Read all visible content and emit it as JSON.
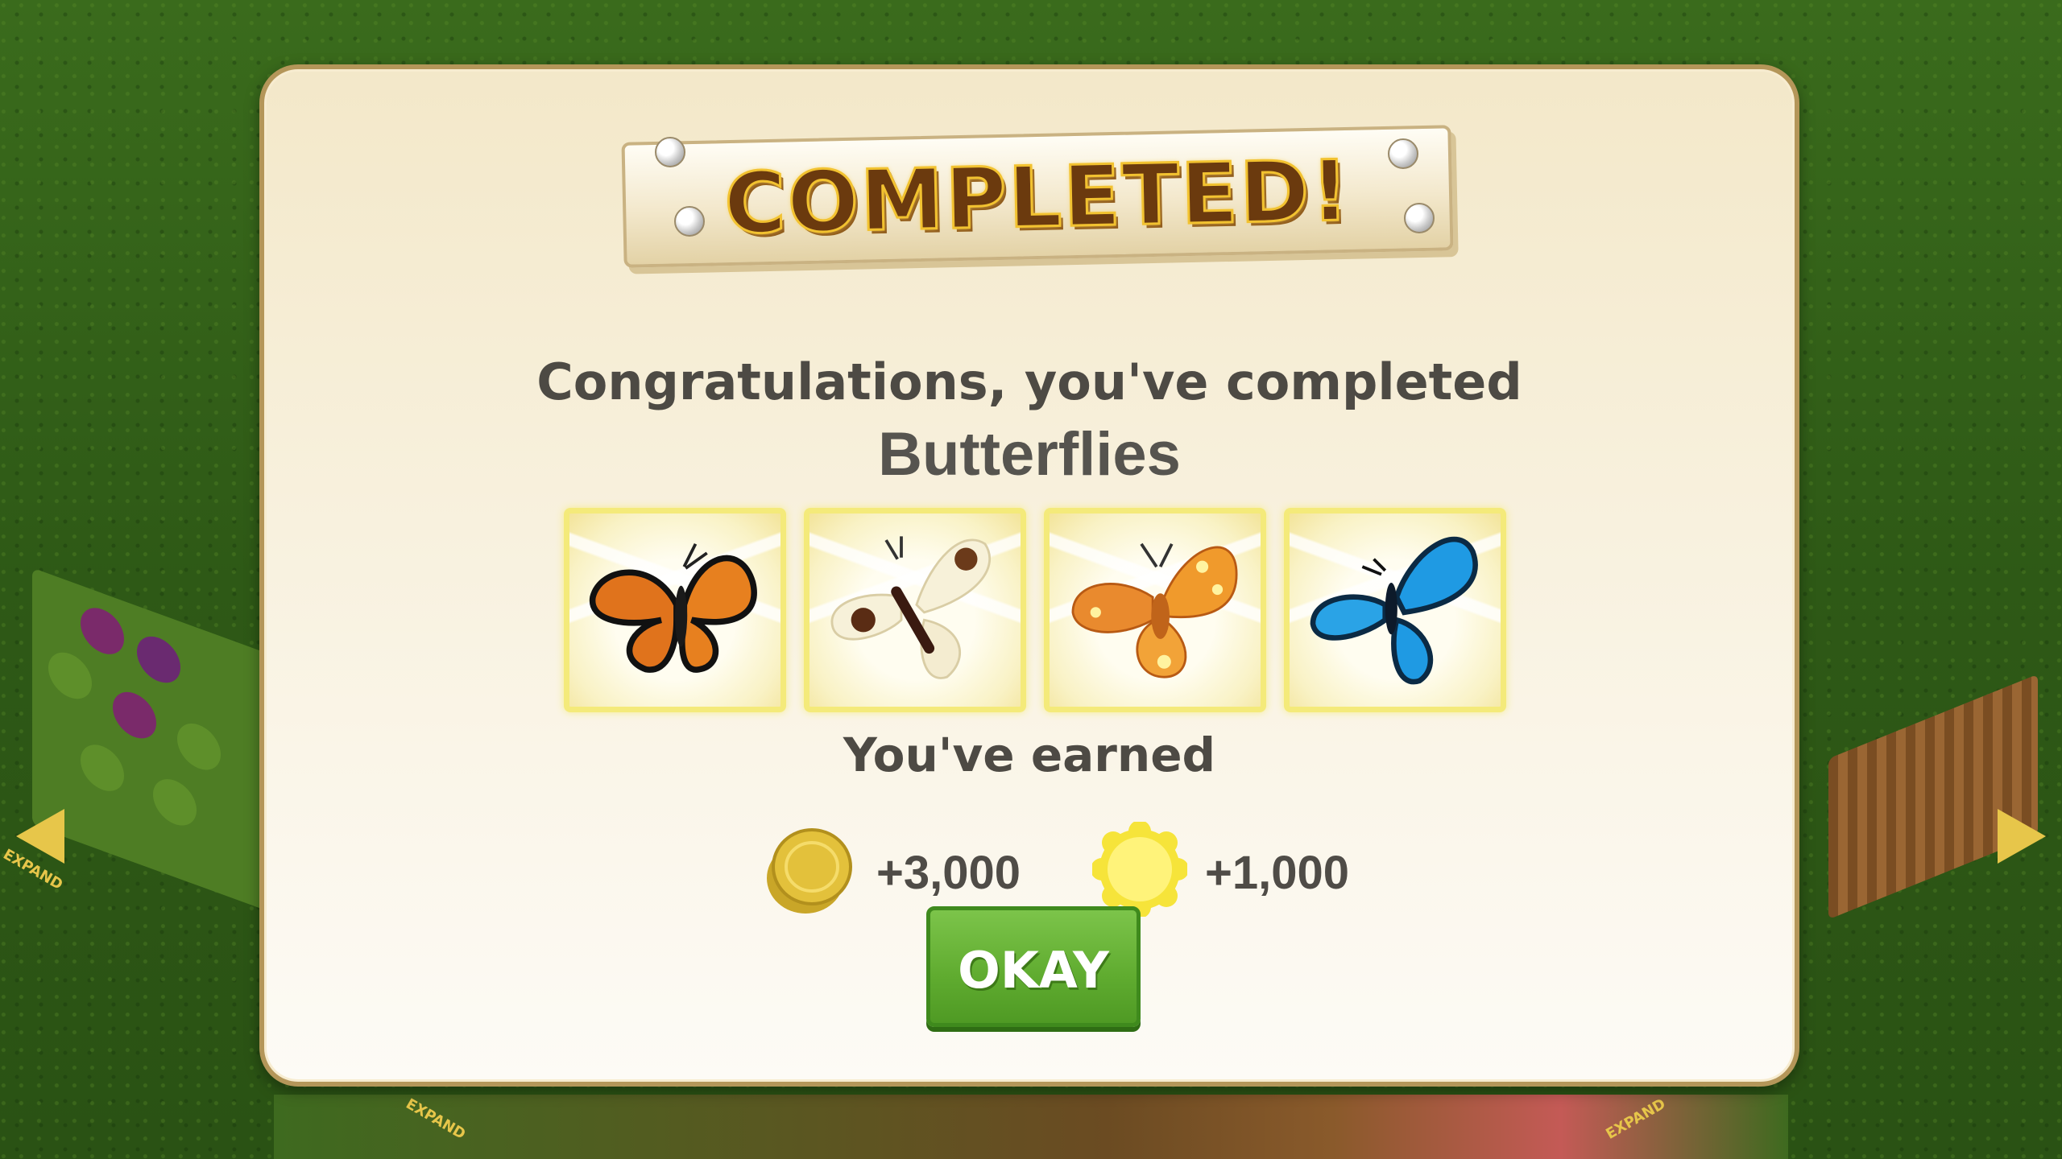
{
  "dialog": {
    "banner_title": "COMPLETED!",
    "message": "Congratulations, you've completed",
    "collection_name": "Butterflies",
    "earned_label": "You've earned",
    "collection_items": [
      {
        "icon": "monarch-butterfly-icon"
      },
      {
        "icon": "cream-spotted-butterfly-icon"
      },
      {
        "icon": "orange-yellow-spotted-butterfly-icon"
      },
      {
        "icon": "blue-morpho-butterfly-icon"
      }
    ],
    "rewards": [
      {
        "icon": "coins-icon",
        "value": "+3,000"
      },
      {
        "icon": "experience-star-icon",
        "value": "+1,000"
      }
    ],
    "okay_label": "OKAY"
  },
  "background": {
    "expand_label": "EXPAND"
  },
  "colors": {
    "dialog_border": "#b49659",
    "button_green": "#5fab2f",
    "tile_border": "#f4ea7a",
    "title_brown": "#6b3a0e"
  }
}
